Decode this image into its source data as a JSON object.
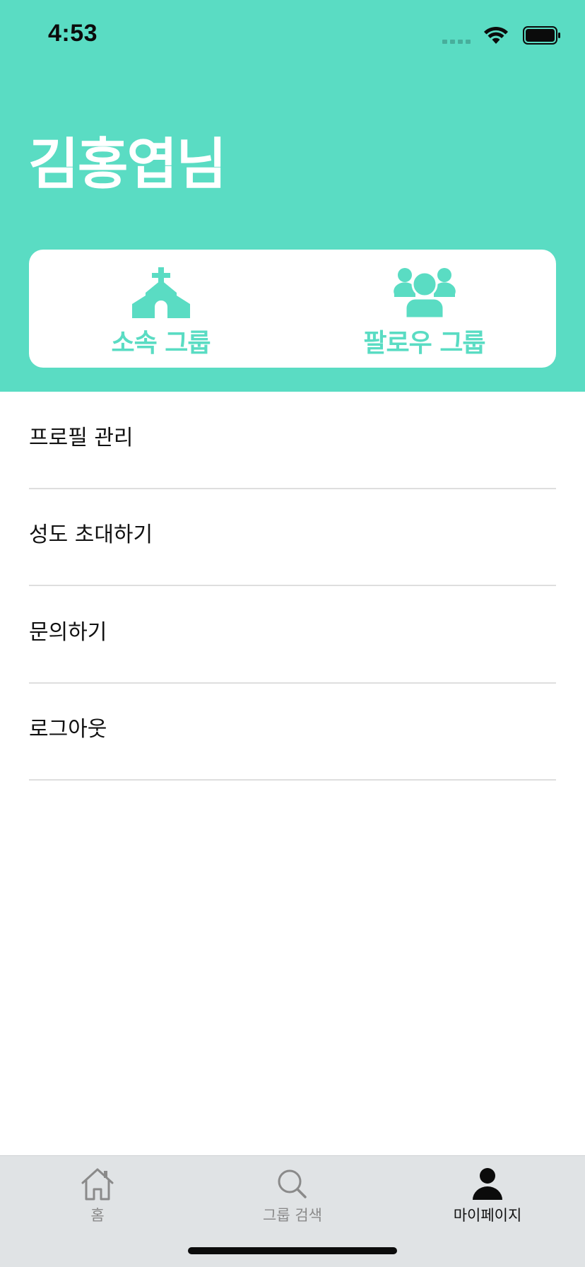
{
  "status_bar": {
    "time": "4:53"
  },
  "header": {
    "title": "김홍엽님",
    "background_color": "#5ADCC3"
  },
  "group_card": {
    "affiliated": {
      "label": "소속 그룹",
      "icon": "church-icon"
    },
    "follow": {
      "label": "팔로우 그룹",
      "icon": "people-group-icon"
    }
  },
  "menu": {
    "items": [
      {
        "label": "프로필 관리"
      },
      {
        "label": "성도 초대하기"
      },
      {
        "label": "문의하기"
      },
      {
        "label": "로그아웃"
      }
    ]
  },
  "tab_bar": {
    "tabs": [
      {
        "label": "홈",
        "icon": "home-icon",
        "active": false
      },
      {
        "label": "그룹 검색",
        "icon": "search-icon",
        "active": false
      },
      {
        "label": "마이페이지",
        "icon": "person-icon",
        "active": true
      }
    ]
  },
  "colors": {
    "accent": "#5ADCC3",
    "tab_bar_bg": "#E0E3E5"
  }
}
